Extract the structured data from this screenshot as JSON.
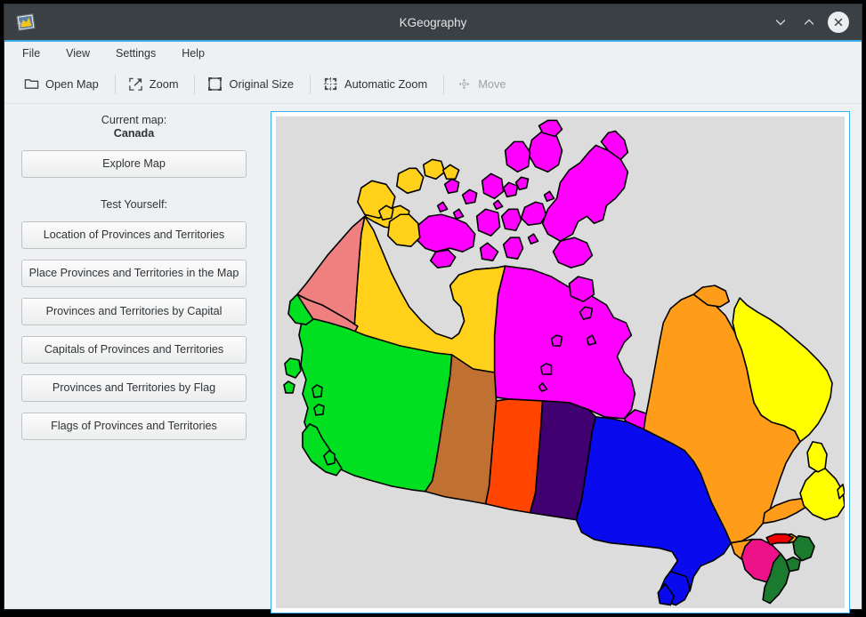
{
  "window": {
    "title": "KGeography",
    "app_icon": "map-picture-icon",
    "controls": {
      "minimize": "chevron-down-icon",
      "maximize": "chevron-up-icon",
      "close": "close-circle-icon"
    }
  },
  "menubar": {
    "items": [
      {
        "label": "File"
      },
      {
        "label": "View"
      },
      {
        "label": "Settings"
      },
      {
        "label": "Help"
      }
    ]
  },
  "toolbar": {
    "items": [
      {
        "label": "Open Map",
        "icon": "folder-icon",
        "enabled": true
      },
      {
        "label": "Zoom",
        "icon": "zoom-expand-icon",
        "enabled": true
      },
      {
        "label": "Original Size",
        "icon": "square-bracket-icon",
        "enabled": true
      },
      {
        "label": "Automatic Zoom",
        "icon": "dashed-square-icon",
        "enabled": true
      },
      {
        "label": "Move",
        "icon": "move-arrows-icon",
        "enabled": false
      }
    ]
  },
  "sidebar": {
    "current_map_label": "Current map:",
    "current_map_name": "Canada",
    "explore_button": "Explore Map",
    "test_yourself_label": "Test Yourself:",
    "test_buttons": [
      "Location of Provinces and Territories",
      "Place Provinces and Territories in the Map",
      "Provinces and Territories by Capital",
      "Capitals of Provinces and Territories",
      "Provinces and Territories by Flag",
      "Flags of Provinces and Territories"
    ]
  },
  "map": {
    "name": "Canada",
    "background_color": "#dcdcdc",
    "border_color": "#000000",
    "frame_accent_color": "#3daee9",
    "regions": [
      {
        "name": "Yukon",
        "color": "#f08080"
      },
      {
        "name": "Northwest Territories",
        "color": "#ffd11a"
      },
      {
        "name": "Nunavut",
        "color": "#ff00ff"
      },
      {
        "name": "British Columbia",
        "color": "#00e020"
      },
      {
        "name": "Alberta",
        "color": "#c07030"
      },
      {
        "name": "Saskatchewan",
        "color": "#ff4500"
      },
      {
        "name": "Manitoba",
        "color": "#400070"
      },
      {
        "name": "Ontario",
        "color": "#0a0aee"
      },
      {
        "name": "Quebec",
        "color": "#ff9c1a"
      },
      {
        "name": "Newfoundland and Labrador",
        "color": "#ffff00"
      },
      {
        "name": "New Brunswick",
        "color": "#ee1289"
      },
      {
        "name": "Nova Scotia",
        "color": "#1a7a2e"
      },
      {
        "name": "Prince Edward Island",
        "color": "#ee0000"
      }
    ]
  }
}
